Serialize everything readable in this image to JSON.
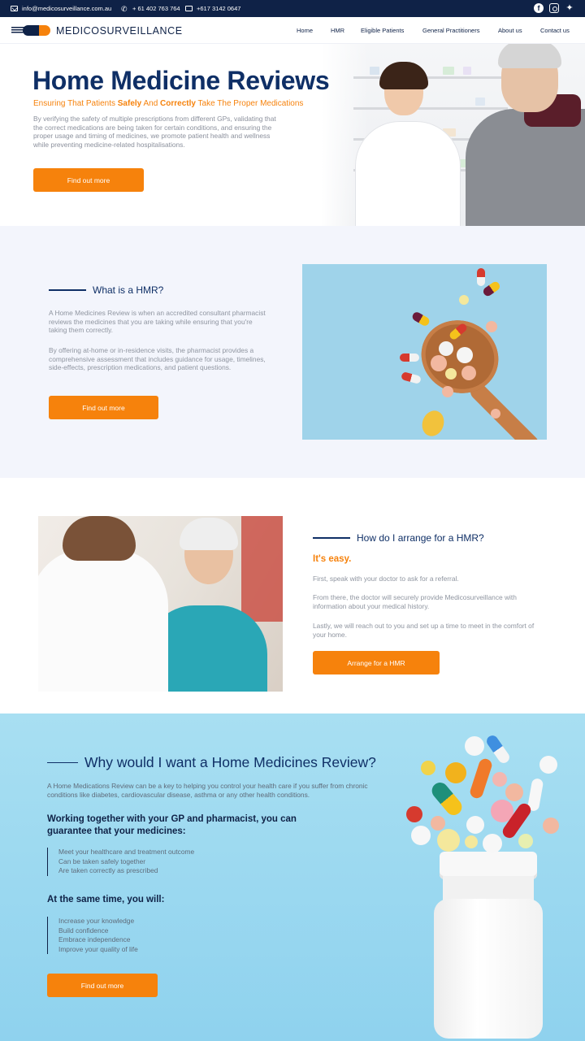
{
  "topbar": {
    "email": "info@medicosurveillance.com.au",
    "phone": "+ 61 402 763 764",
    "fax": "+617 3142 0647"
  },
  "header": {
    "logo_text": "MEDICOSURVEILLANCE",
    "nav": [
      "Home",
      "HMR",
      "Eligible Patients",
      "General Practitioners",
      "About us",
      "Contact us"
    ]
  },
  "hero": {
    "title": "Home Medicine Reviews",
    "subtitle_pre": "Ensuring That Patients ",
    "subtitle_safely": "Safely",
    "subtitle_and": " And ",
    "subtitle_correctly": "Correctly",
    "subtitle_post": " Take The Proper Medications",
    "text": "By verifying the safety of multiple prescriptions from different GPs, validating that the correct medications are being taken for certain conditions, and ensuring the proper usage and timing of medicines, we promote patient health and wellness while preventing medicine-related hospitalisations.",
    "button": "Find out more"
  },
  "what_hmr": {
    "heading": "What is a HMR?",
    "para1": "A Home Medicines Review is when an accredited consultant pharmacist reviews the medicines that you are taking while ensuring that you're taking them correctly.",
    "para2": "By offering at-home or in-residence visits, the pharmacist provides a comprehensive assessment that includes guidance for usage, timelines, side-effects, prescription medications, and patient questions.",
    "button": "Find out more"
  },
  "arrange": {
    "heading": "How do I arrange for a HMR?",
    "easy": "It's easy.",
    "para1": "First, speak with your doctor to ask for a referral.",
    "para2": "From there, the doctor will securely provide Medicosurveillance with information about your medical history.",
    "para3": "Lastly, we will reach out to you and set up a time to meet in the comfort of your home.",
    "button": "Arrange for a HMR"
  },
  "why": {
    "heading": "Why would I want a Home Medicines Review?",
    "text": "A Home Medications Review can be a key to helping you control your health care if you suffer from chronic conditions like diabetes, cardiovascular disease, asthma or any other health conditions.",
    "sub1": "Working together with your GP and pharmacist, you can guarantee that your medicines:",
    "list1": [
      "Meet your healthcare and treatment outcome",
      "Can be taken safely together",
      "Are taken correctly as prescribed"
    ],
    "sub2": "At the same time, you will:",
    "list2": [
      "Increase your knowledge",
      "Build confidence",
      "Embrace independence",
      "Improve your quality of life"
    ],
    "button": "Find out more"
  },
  "colors": {
    "navy": "#0f2247",
    "accent": "#f6820c",
    "section_bg": "#f3f5fc",
    "why_bg": "#a8dff2"
  },
  "icons": [
    "envelope-icon",
    "phone-icon",
    "fax-icon",
    "facebook-icon",
    "instagram-icon",
    "twitter-icon"
  ]
}
